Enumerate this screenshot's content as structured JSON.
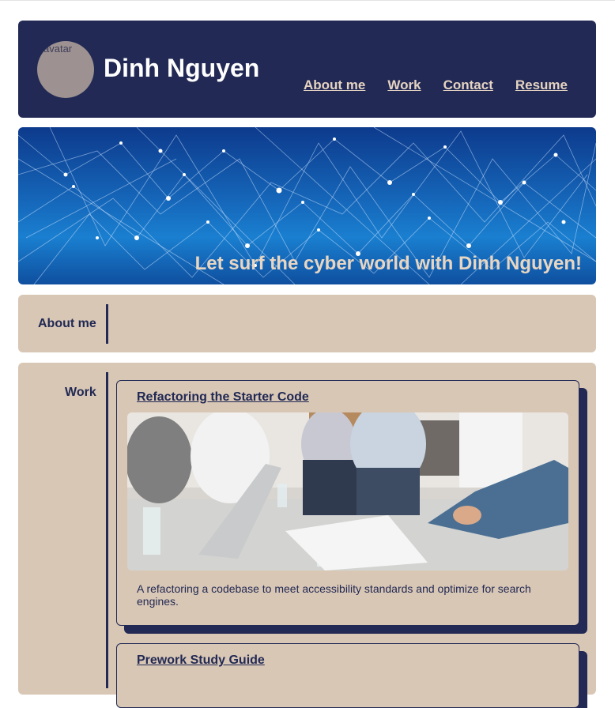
{
  "header": {
    "avatar_alt": "avatar",
    "title": "Dinh Nguyen",
    "nav": [
      {
        "label": "About me"
      },
      {
        "label": "Work"
      },
      {
        "label": "Contact"
      },
      {
        "label": "Resume"
      }
    ]
  },
  "hero": {
    "tagline": "Let surf the cyber world with Dinh Nguyen!"
  },
  "about": {
    "label": "About me"
  },
  "work": {
    "label": "Work",
    "projects": [
      {
        "title": "Refactoring the Starter Code",
        "description": "A refactoring a codebase to meet accessibility standards and optimize for search engines."
      },
      {
        "title": "Prework Study Guide"
      }
    ]
  },
  "colors": {
    "navy": "#212954",
    "tan": "#d9c7b5",
    "nav_link": "#e6d4c2"
  }
}
